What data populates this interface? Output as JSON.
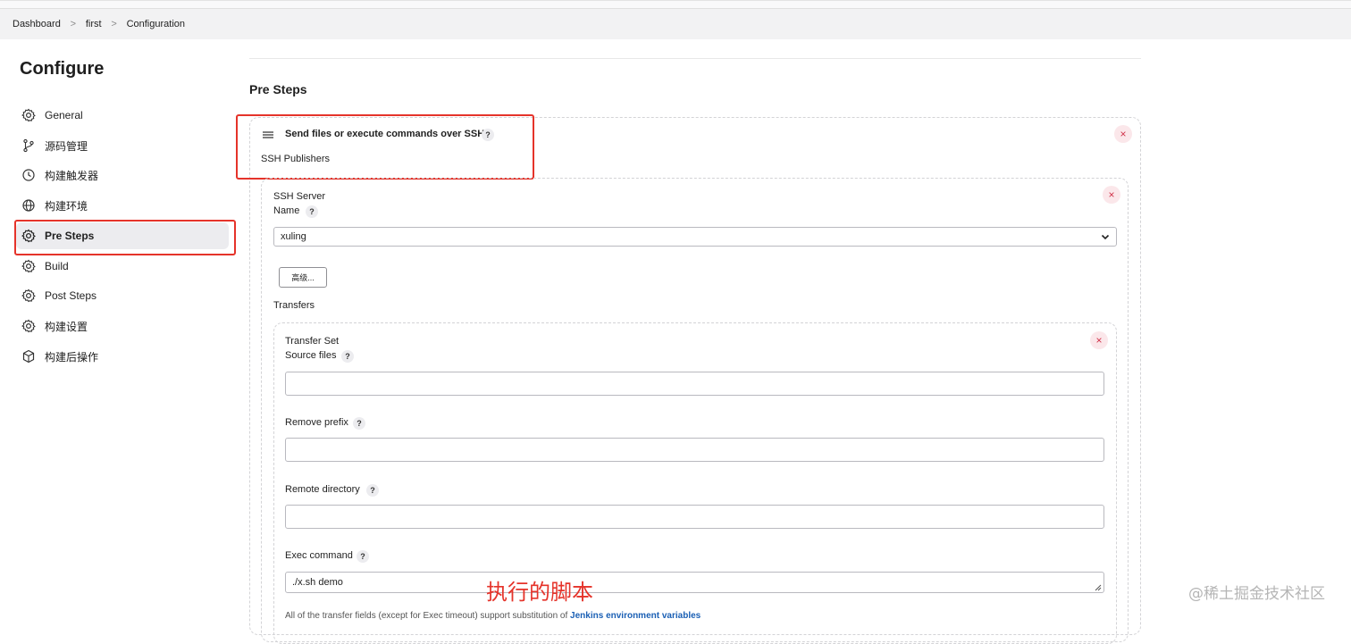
{
  "breadcrumb": {
    "items": [
      "Dashboard",
      "first",
      "Configuration"
    ],
    "separator": ">"
  },
  "sidebar": {
    "title": "Configure",
    "items": [
      {
        "label": "General",
        "icon": "gear-icon"
      },
      {
        "label": "源码管理",
        "icon": "branch-icon"
      },
      {
        "label": "构建触发器",
        "icon": "clock-icon"
      },
      {
        "label": "构建环境",
        "icon": "globe-icon"
      },
      {
        "label": "Pre Steps",
        "icon": "gear-icon",
        "active": true
      },
      {
        "label": "Build",
        "icon": "gear-icon"
      },
      {
        "label": "Post Steps",
        "icon": "gear-icon"
      },
      {
        "label": "构建设置",
        "icon": "gear-icon"
      },
      {
        "label": "构建后操作",
        "icon": "cube-icon"
      }
    ]
  },
  "main": {
    "section_title": "Pre Steps",
    "step": {
      "title": "Send files or execute commands over SSH",
      "subtitle": "SSH Publishers",
      "help": "?",
      "close": "×"
    },
    "ssh_server": {
      "label": "SSH Server",
      "name_label": "Name",
      "help": "?",
      "selected": "xuling",
      "advanced_button": "高级...",
      "close": "×"
    },
    "transfers_label": "Transfers",
    "transfer_set": {
      "title": "Transfer Set",
      "close": "×",
      "source_files_label": "Source files",
      "source_files_value": "",
      "remove_prefix_label": "Remove prefix",
      "remove_prefix_value": "",
      "remote_directory_label": "Remote directory",
      "remote_directory_value": "",
      "exec_command_label": "Exec command",
      "exec_command_value": "./x.sh demo",
      "help": "?"
    },
    "footnote_text": "All of the transfer fields (except for Exec timeout) support substitution of ",
    "footnote_link": "Jenkins environment variables"
  },
  "annotation": "执行的脚本",
  "watermark": "@稀土掘金技术社区",
  "colors": {
    "highlight_red": "#e5332a",
    "close_red": "#d0334a",
    "link_blue": "#1a5fb4"
  }
}
